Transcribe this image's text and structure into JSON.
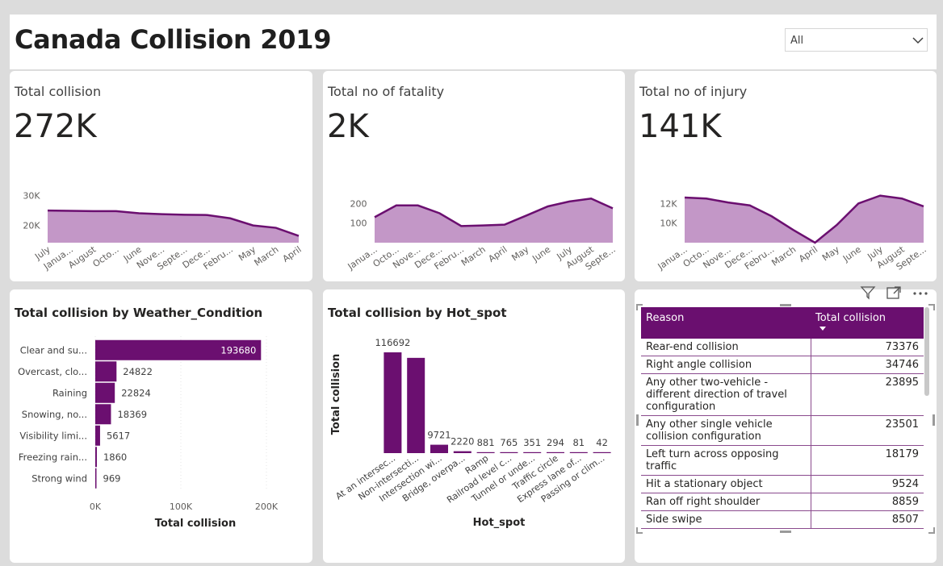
{
  "header": {
    "title": "Canada Collision 2019",
    "slicer_value": "All",
    "chevron_icon": "chevron-down-icon"
  },
  "kpis": [
    {
      "label": "Total collision",
      "value": "272K",
      "chart_data": {
        "type": "area",
        "x": [
          "July",
          "Janua...",
          "August",
          "Octo...",
          "June",
          "Nove...",
          "Septe...",
          "Dece...",
          "Febru...",
          "May",
          "March",
          "April"
        ],
        "values": [
          25000,
          24900,
          24800,
          24800,
          24100,
          23800,
          23600,
          23500,
          22400,
          20000,
          19200,
          16500
        ],
        "yticks": [
          "20K",
          "30K"
        ],
        "ytick_values": [
          20000,
          30000
        ],
        "ylim": [
          14200,
          34000
        ],
        "color": "#6b0f70",
        "fill": "#c397c7"
      }
    },
    {
      "label": "Total no of fatality",
      "value": "2K",
      "chart_data": {
        "type": "area",
        "x": [
          "Janua...",
          "Octo...",
          "Nove...",
          "Dece...",
          "Febru...",
          "March",
          "April",
          "May",
          "June",
          "July",
          "August",
          "Septe..."
        ],
        "values": [
          130,
          190,
          190,
          150,
          85,
          88,
          92,
          138,
          185,
          210,
          225,
          175
        ],
        "yticks": [
          "100",
          "200"
        ],
        "ytick_values": [
          100,
          200
        ],
        "ylim": [
          0,
          300
        ],
        "color": "#6b0f70",
        "fill": "#c397c7"
      }
    },
    {
      "label": "Total no of injury",
      "value": "141K",
      "chart_data": {
        "type": "area",
        "x": [
          "Janua...",
          "Octo...",
          "Nove...",
          "Dece...",
          "Febru...",
          "March",
          "April",
          "May",
          "June",
          "July",
          "August",
          "Septe..."
        ],
        "values": [
          12600,
          12500,
          12100,
          11800,
          10700,
          9300,
          8000,
          9800,
          12000,
          12800,
          12500,
          11700
        ],
        "yticks": [
          "10K",
          "12K"
        ],
        "ytick_values": [
          10000,
          12000
        ],
        "ylim": [
          8000,
          14000
        ],
        "color": "#6b0f70",
        "fill": "#c397c7"
      }
    }
  ],
  "weather_chart": {
    "title": "Total collision by Weather_Condition",
    "xlabel": "Total collision",
    "chart_data": {
      "type": "bar",
      "orientation": "horizontal",
      "categories": [
        "Clear and su...",
        "Overcast, clo...",
        "Raining",
        "Snowing, no...",
        "Visibility limi...",
        "Freezing rain...",
        "Strong wind"
      ],
      "values": [
        193680,
        24822,
        22824,
        18369,
        5617,
        1860,
        969
      ],
      "xticks": [
        "0K",
        "100K",
        "200K"
      ],
      "xtick_values": [
        0,
        100000,
        200000
      ],
      "xlim": [
        0,
        215000
      ],
      "color": "#6b0f70"
    }
  },
  "hotspot_chart": {
    "title": "Total collision by Hot_spot",
    "xlabel": "Hot_spot",
    "ylabel": "Total collision",
    "chart_data": {
      "type": "bar",
      "orientation": "vertical",
      "categories": [
        "At an intersec...",
        "Non-intersecti...",
        "Intersection wi...",
        "Bridge, overpa...",
        "Ramp",
        "Railroad level c...",
        "Tunnel or unde...",
        "Traffic circle",
        "Express lane of...",
        "Passing or clim..."
      ],
      "values": [
        116692,
        110300,
        9721,
        2220,
        881,
        765,
        351,
        294,
        81,
        42
      ],
      "labels": [
        "116692",
        "",
        "9721",
        "2220",
        "881",
        "765",
        "351",
        "294",
        "81",
        "42"
      ],
      "ylim": [
        0,
        116692
      ],
      "color": "#6b0f70"
    }
  },
  "reason_table": {
    "columns": [
      "Reason",
      "Total collision"
    ],
    "sort_icon": "sort-descending-icon",
    "rows": [
      [
        "Rear-end collision",
        "73376"
      ],
      [
        "Right angle collision",
        "34746"
      ],
      [
        "Any other two-vehicle - different direction of travel configuration",
        "23895"
      ],
      [
        "Any other single vehicle collision configuration",
        "23501"
      ],
      [
        "Left turn across opposing traffic",
        "18179"
      ],
      [
        "Hit a stationary object",
        "9524"
      ],
      [
        "Ran off right shoulder",
        "8859"
      ],
      [
        "Side swipe",
        "8507"
      ]
    ]
  },
  "visual_toolbar": {
    "icons": [
      "filter-icon",
      "focus-mode-icon",
      "more-options-icon"
    ]
  }
}
